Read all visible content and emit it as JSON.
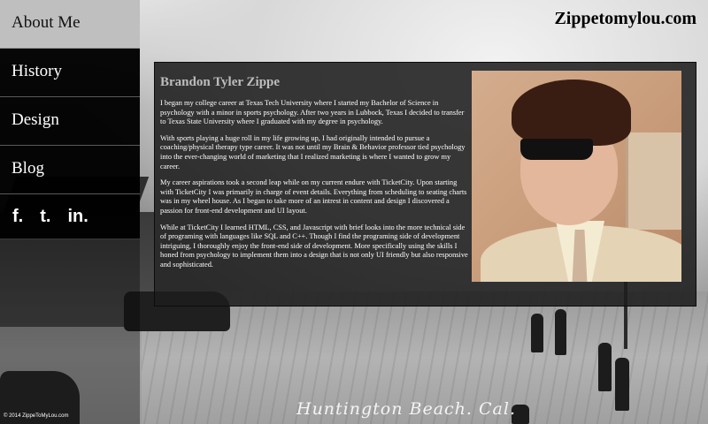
{
  "brand": "Zippetomylou.com",
  "nav": {
    "items": [
      {
        "label": "About Me",
        "active": true
      },
      {
        "label": "History",
        "active": false
      },
      {
        "label": "Design",
        "active": false
      },
      {
        "label": "Blog",
        "active": false
      }
    ]
  },
  "social": {
    "facebook": "f.",
    "twitter": "t.",
    "linkedin": "in."
  },
  "copyright": "© 2014 ZippeToMyLou.com",
  "background_caption": "Huntington Beach. Cal.",
  "about": {
    "name": "Brandon Tyler Zippe",
    "paragraphs": [
      "I began my college career at Texas Tech University where I started my Bachelor of Science in psychology with a minor in sports psychology. After two years in Lubbock, Texas I decided to transfer to Texas State University where I graduated with my degree in psychology.",
      "With sports playing a huge roll in my life growing up, I had originally intended to pursue a coaching/physical therapy type career. It was not until my Brain & Behavior professor tied psychology into the ever-changing world of marketing that I realized marketing is where I wanted to grow my career.",
      "My career aspirations took a second leap while on my current endure with TicketCity. Upon starting with TicketCity I was primarily in charge of event details. Everything from scheduling to seating charts was in my wheel house. As I began to take more of an intrest in content and design I discovered a passion for front-end development and UI layout.",
      "While at TicketCity I learned HTML, CSS, and Javascript with brief looks into the more technical side of programing with languages like SQL and C++. Though I find the programing side of development intriguing, I thoroughly enjoy the front-end side of development. More specifically using the skills I honed from psychology to implement them into a design that is not only UI friendly but also responsive and sophisticated."
    ]
  },
  "colors": {
    "sidebar_bg": "#000000",
    "active_nav_bg": "#bfbfbf",
    "panel_bg": "#1e1e1e",
    "name_color": "#bdbdbd"
  }
}
